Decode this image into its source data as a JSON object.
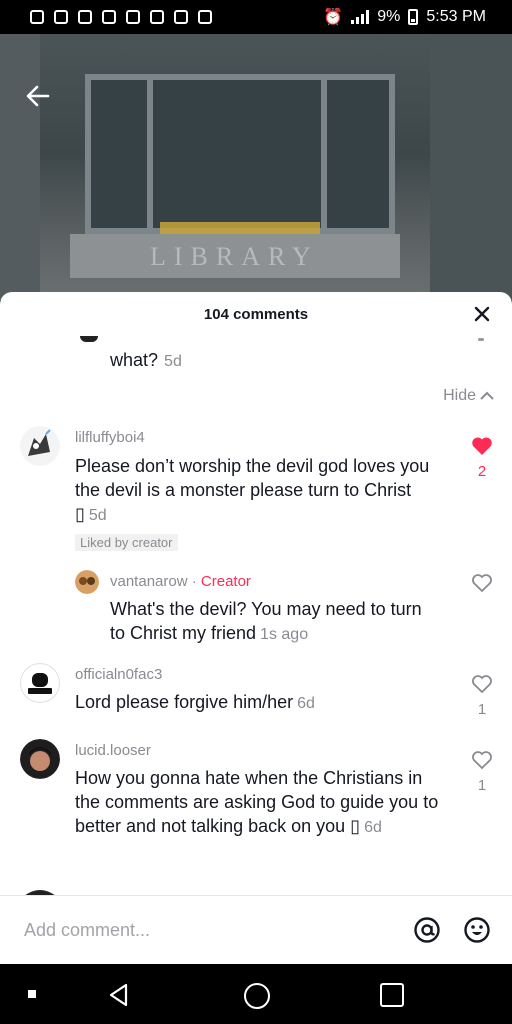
{
  "status_bar": {
    "battery": "9%",
    "time": "5:53 PM"
  },
  "sheet": {
    "title": "104 comments"
  },
  "previous_reply": {
    "text": "what?",
    "time": "5d"
  },
  "hide_label": "Hide",
  "comments": [
    {
      "username": "lilfluffyboi4",
      "text": "Please don’t worship the devil god loves you the devil is a monster please turn to Christ ▯",
      "time": "5d",
      "badge": "Liked by creator",
      "likes": "2",
      "liked": true,
      "avatar_color": "#3a3a3a"
    },
    {
      "username": "vantanarow",
      "separator": "·",
      "role": "Creator",
      "text": "What's the devil? You may need to turn to Christ my friend",
      "time": "1s ago",
      "likes": "",
      "liked": false,
      "avatar_color": "#b3773a"
    },
    {
      "username": "officialn0fac3",
      "text": "Lord please forgive him/her",
      "time": "6d",
      "likes": "1",
      "liked": false,
      "avatar_color": "#ffffff"
    },
    {
      "username": "lucid.looser",
      "text": "How you gonna hate when the Christians in the comments are asking God to guide you to better and not talking back on you ▯",
      "time": "6d",
      "likes": "1",
      "liked": false,
      "avatar_color": "#2a2a2a"
    }
  ],
  "composer": {
    "placeholder": "Add comment..."
  },
  "colors": {
    "accent": "#fe2c55",
    "muted": "#8a8b91",
    "text": "#161823"
  },
  "video_sign": "LIBRARY"
}
